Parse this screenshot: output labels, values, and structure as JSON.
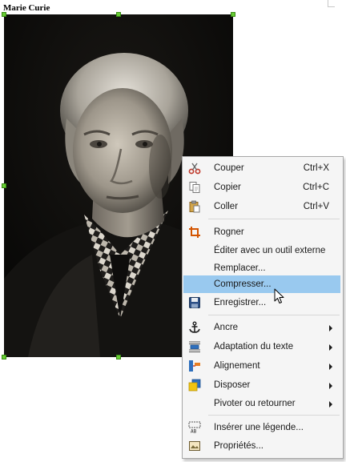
{
  "document": {
    "caption": "Marie Curie"
  },
  "photo": {
    "subject": "portrait"
  },
  "context_menu": {
    "items": [
      {
        "label": "Couper",
        "shortcut": "Ctrl+X",
        "icon": "scissors-icon"
      },
      {
        "label": "Copier",
        "shortcut": "Ctrl+C",
        "icon": "copy-icon"
      },
      {
        "label": "Coller",
        "shortcut": "Ctrl+V",
        "icon": "paste-icon"
      },
      {
        "label": "Rogner",
        "icon": "crop-icon"
      },
      {
        "label": "Éditer avec un outil externe"
      },
      {
        "label": "Remplacer..."
      },
      {
        "label": "Compresser...",
        "highlighted": true
      },
      {
        "label": "Enregistrer...",
        "icon": "save-icon"
      },
      {
        "label": "Ancre",
        "submenu": true,
        "icon": "anchor-icon"
      },
      {
        "label": "Adaptation du texte",
        "submenu": true,
        "icon": "wrap-icon"
      },
      {
        "label": "Alignement",
        "submenu": true,
        "icon": "align-icon"
      },
      {
        "label": "Disposer",
        "submenu": true,
        "icon": "arrange-icon"
      },
      {
        "label": "Pivoter ou retourner",
        "submenu": true
      },
      {
        "label": "Insérer une légende...",
        "icon": "caption-icon"
      },
      {
        "label": "Propriétés...",
        "icon": "properties-icon"
      }
    ]
  },
  "colors": {
    "selection_handle": "#66cc33",
    "menu_highlight": "#99c9ef",
    "menu_background": "#f5f5f5"
  }
}
